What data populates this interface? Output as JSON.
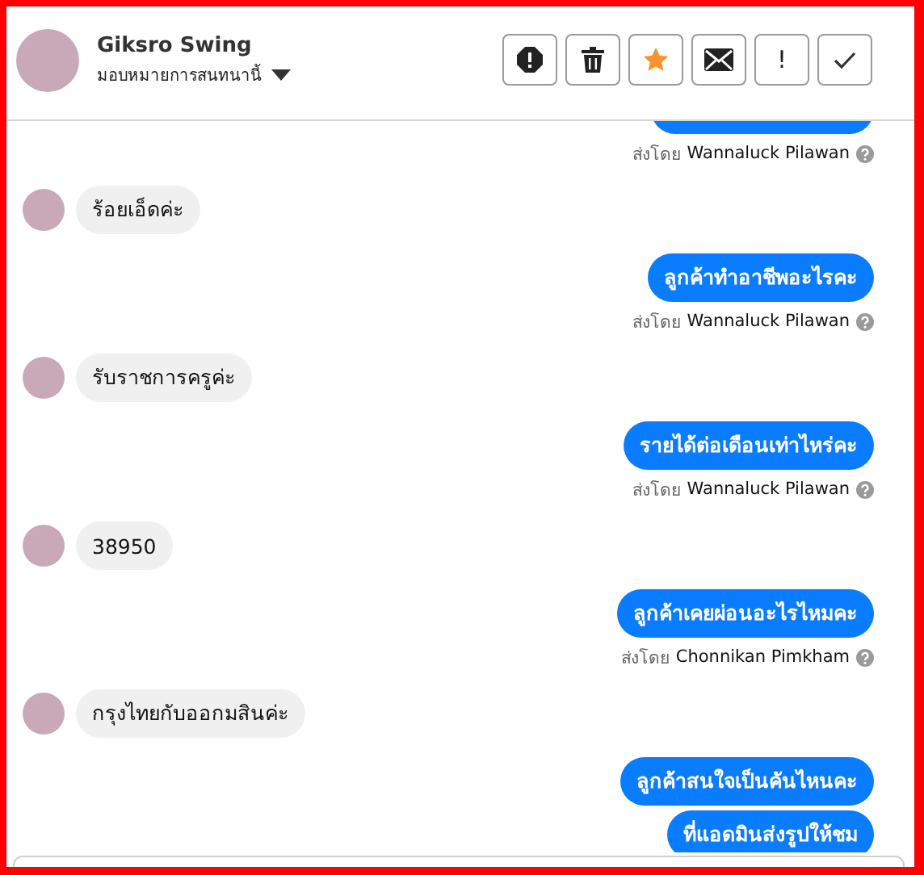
{
  "contact": {
    "name": "Giksro Swing",
    "assignment": "มอบหมายการสนทนานี้"
  },
  "actions": [
    {
      "kind": "alert"
    },
    {
      "kind": "trash"
    },
    {
      "kind": "star"
    },
    {
      "kind": "mail"
    },
    {
      "kind": "text",
      "label": "!"
    },
    {
      "kind": "check"
    }
  ],
  "messages": [
    {
      "kind": "outgoing"
    },
    {
      "kind": "sender",
      "label": "ส่งโดย",
      "name": "Wannaluck Pilawan"
    },
    {
      "kind": "incoming",
      "text": "ร้อยเอ็ดค่ะ"
    },
    {
      "kind": "outgoing",
      "text": "ลูกค้าทำอาชีพอะไรคะ"
    },
    {
      "kind": "sender",
      "label": "ส่งโดย",
      "name": "Wannaluck Pilawan"
    },
    {
      "kind": "incoming",
      "text": "รับราชการครูค่ะ"
    },
    {
      "kind": "outgoing",
      "text": "รายได้ต่อเดือนเท่าไหร่คะ"
    },
    {
      "kind": "sender",
      "label": "ส่งโดย",
      "name": "Wannaluck Pilawan"
    },
    {
      "kind": "incoming",
      "text": "38950"
    },
    {
      "kind": "outgoing",
      "text": "ลูกค้าเคยผ่อนอะไรไหมคะ"
    },
    {
      "kind": "sender",
      "label": "ส่งโดย",
      "name": "Chonnikan Pimkham"
    },
    {
      "kind": "incoming",
      "text": "กรุงไทยกับออกมสินค่ะ"
    },
    {
      "kind": "outgoing",
      "text": "ลูกค้าสนใจเป็นคันไหนคะ"
    },
    {
      "kind": "outgoing",
      "text": "ที่แอดมินส่งรูปให้ชม"
    }
  ]
}
